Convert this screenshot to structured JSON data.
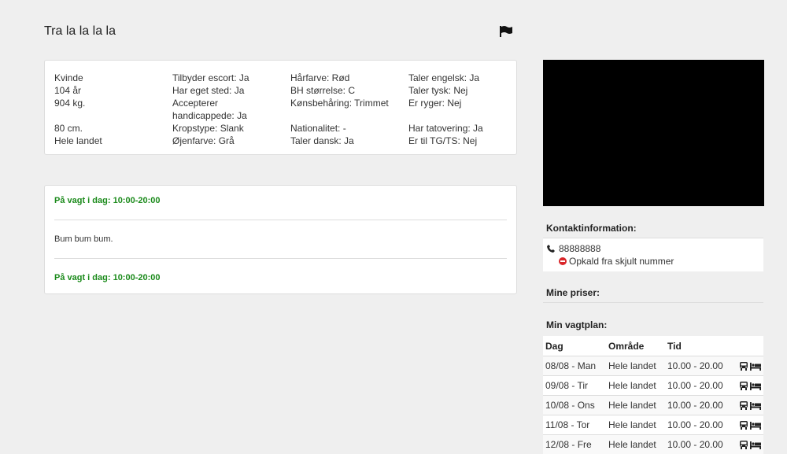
{
  "profile": {
    "title": "Tra la la la la"
  },
  "info": {
    "col1": [
      "Kvinde",
      "104 år",
      "904 kg.",
      "",
      "80 cm.",
      "Hele landet"
    ],
    "col2": [
      "Tilbyder escort: Ja",
      "Har eget sted: Ja",
      "Accepterer",
      "handicappede: Ja",
      "Kropstype: Slank",
      "Øjenfarve: Grå"
    ],
    "col3": [
      "Hårfarve: Rød",
      "BH størrelse: C",
      "Kønsbehåring: Trimmet",
      "",
      "Nationalitet: -",
      "Taler dansk: Ja"
    ],
    "col4": [
      "Taler engelsk: Ja",
      "Taler tysk: Nej",
      "Er ryger: Nej",
      "",
      "Har tatovering: Ja",
      "Er til TG/TS: Nej"
    ]
  },
  "schedule_card": {
    "top_status": "På vagt i dag: 10:00-20:00",
    "description": "Bum bum bum.",
    "bottom_status": "På vagt i dag: 10:00-20:00"
  },
  "contact": {
    "heading": "Kontaktinformation:",
    "phone": "88888888",
    "note": "Opkald fra skjult nummer"
  },
  "prices": {
    "heading": "Mine priser:"
  },
  "plan": {
    "heading": "Min vagtplan:",
    "columns": [
      "Dag",
      "Område",
      "Tid"
    ],
    "rows": [
      {
        "day": "08/08 - Man",
        "area": "Hele landet",
        "time": "10.00 - 20.00"
      },
      {
        "day": "09/08 - Tir",
        "area": "Hele landet",
        "time": "10.00 - 20.00"
      },
      {
        "day": "10/08 - Ons",
        "area": "Hele landet",
        "time": "10.00 - 20.00"
      },
      {
        "day": "11/08 - Tor",
        "area": "Hele landet",
        "time": "10.00 - 20.00"
      },
      {
        "day": "12/08 - Fre",
        "area": "Hele landet",
        "time": "10.00 - 20.00"
      }
    ]
  },
  "icons": {
    "flag": "flag-icon",
    "phone": "phone-icon",
    "no_entry": "no-entry-icon",
    "car": "car-icon",
    "bed": "bed-icon"
  },
  "colors": {
    "accent_green": "#1a8a1a",
    "warning_red": "#d9262a"
  }
}
